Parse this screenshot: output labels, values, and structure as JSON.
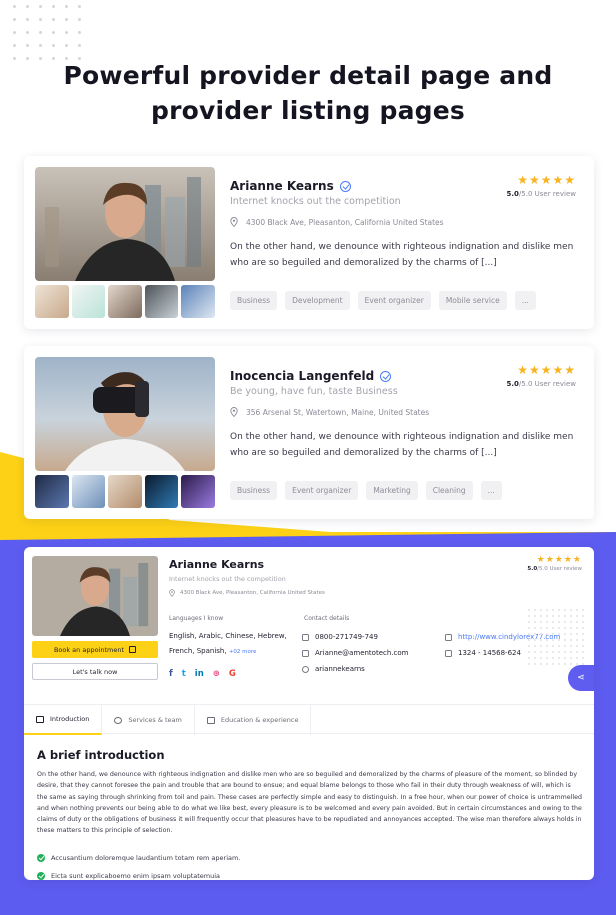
{
  "headline": {
    "line1": "Powerful provider detail page and",
    "line2": "provider listing pages"
  },
  "colors": {
    "accent_yellow": "#fcd116",
    "accent_purple": "#5f5df0",
    "link_blue": "#4a7bf7",
    "star": "#f8b320",
    "check_green": "#22b15a"
  },
  "listing_cards": [
    {
      "name": "Arianne Kearns",
      "tagline": "Internet knocks out the competition",
      "address": "4300 Black Ave, Pleasanton, California United States",
      "description": "On the other hand, we denounce with righteous indignation and dislike men who are so beguiled and demoralized by the charms of [...]",
      "rating_value": "5.0",
      "rating_max": "/5.0",
      "rating_label": "User review",
      "tags": [
        "Business",
        "Development",
        "Event organizer",
        "Mobile service",
        "..."
      ]
    },
    {
      "name": "Inocencia Langenfeld",
      "tagline": "Be young, have fun, taste Business",
      "address": "356 Arsenal St, Watertown, Maine, United States",
      "description": "On the other hand, we denounce with righteous indignation and dislike men who are so beguiled and demoralized by the charms of [...]",
      "rating_value": "5.0",
      "rating_max": "/5.0",
      "rating_label": "User review",
      "tags": [
        "Business",
        "Event organizer",
        "Marketing",
        "Cleaning",
        "..."
      ]
    }
  ],
  "detail": {
    "name": "Arianne Kearns",
    "tagline": "Internet knocks out the competition",
    "address": "4300 Black Ave, Pleasanton, California United States",
    "rating_value": "5.0",
    "rating_max": "/5.0",
    "rating_label": "User review",
    "appointment_button": "Book an appointment",
    "talk_button": "Let's talk now",
    "languages_label": "Languages I know",
    "languages_line1": "English,  Arabic,  Chinese,  Hebrew,",
    "languages_line2": "French,  Spanish,",
    "languages_more": "+02 more",
    "contact_label": "Contact details",
    "phone": "0800-271749-749",
    "email": "Arianne@amentotech.com",
    "skype": "ariannekearns",
    "website": "http://www.cindylorex77.com",
    "fax": "1324 - 14568-624",
    "socials": [
      {
        "glyph": "f",
        "color": "#3b5998"
      },
      {
        "glyph": "t",
        "color": "#1da1f2"
      },
      {
        "glyph": "in",
        "color": "#0077b5"
      },
      {
        "glyph": "⊛",
        "color": "#ea4c89"
      },
      {
        "glyph": "G",
        "color": "#ea4335"
      }
    ],
    "tabs": [
      "Introduction",
      "Services & team",
      "Education & experience"
    ],
    "intro_title": "A brief introduction",
    "intro_text": "On the other hand, we denounce with righteous indignation and dislike men who are so beguiled and demoralized by the charms of pleasure of the moment, so blinded by desire, that they cannot foresee the pain and trouble that are bound to ensue; and equal blame belongs to those who fail in their duty through weakness of will, which is the same as saying through shrinking from toil and pain. These cases are perfectly simple and easy to distinguish. In a free hour, when our power of choice is untrammelled and when nothing prevents our being able to do what we like best, every pleasure is to be welcomed and every pain avoided. But in certain circumstances and owing to the claims of duty or the obligations of business it will frequently occur that pleasures have to be repudiated and annoyances accepted. The wise man therefore always holds in these matters to this principle of selection.",
    "checklist": [
      "Accusantium doloremque laudantium totam rem aperiam.",
      "Eicta sunt explicaboemo enim ipsam voluptatemuia"
    ]
  }
}
